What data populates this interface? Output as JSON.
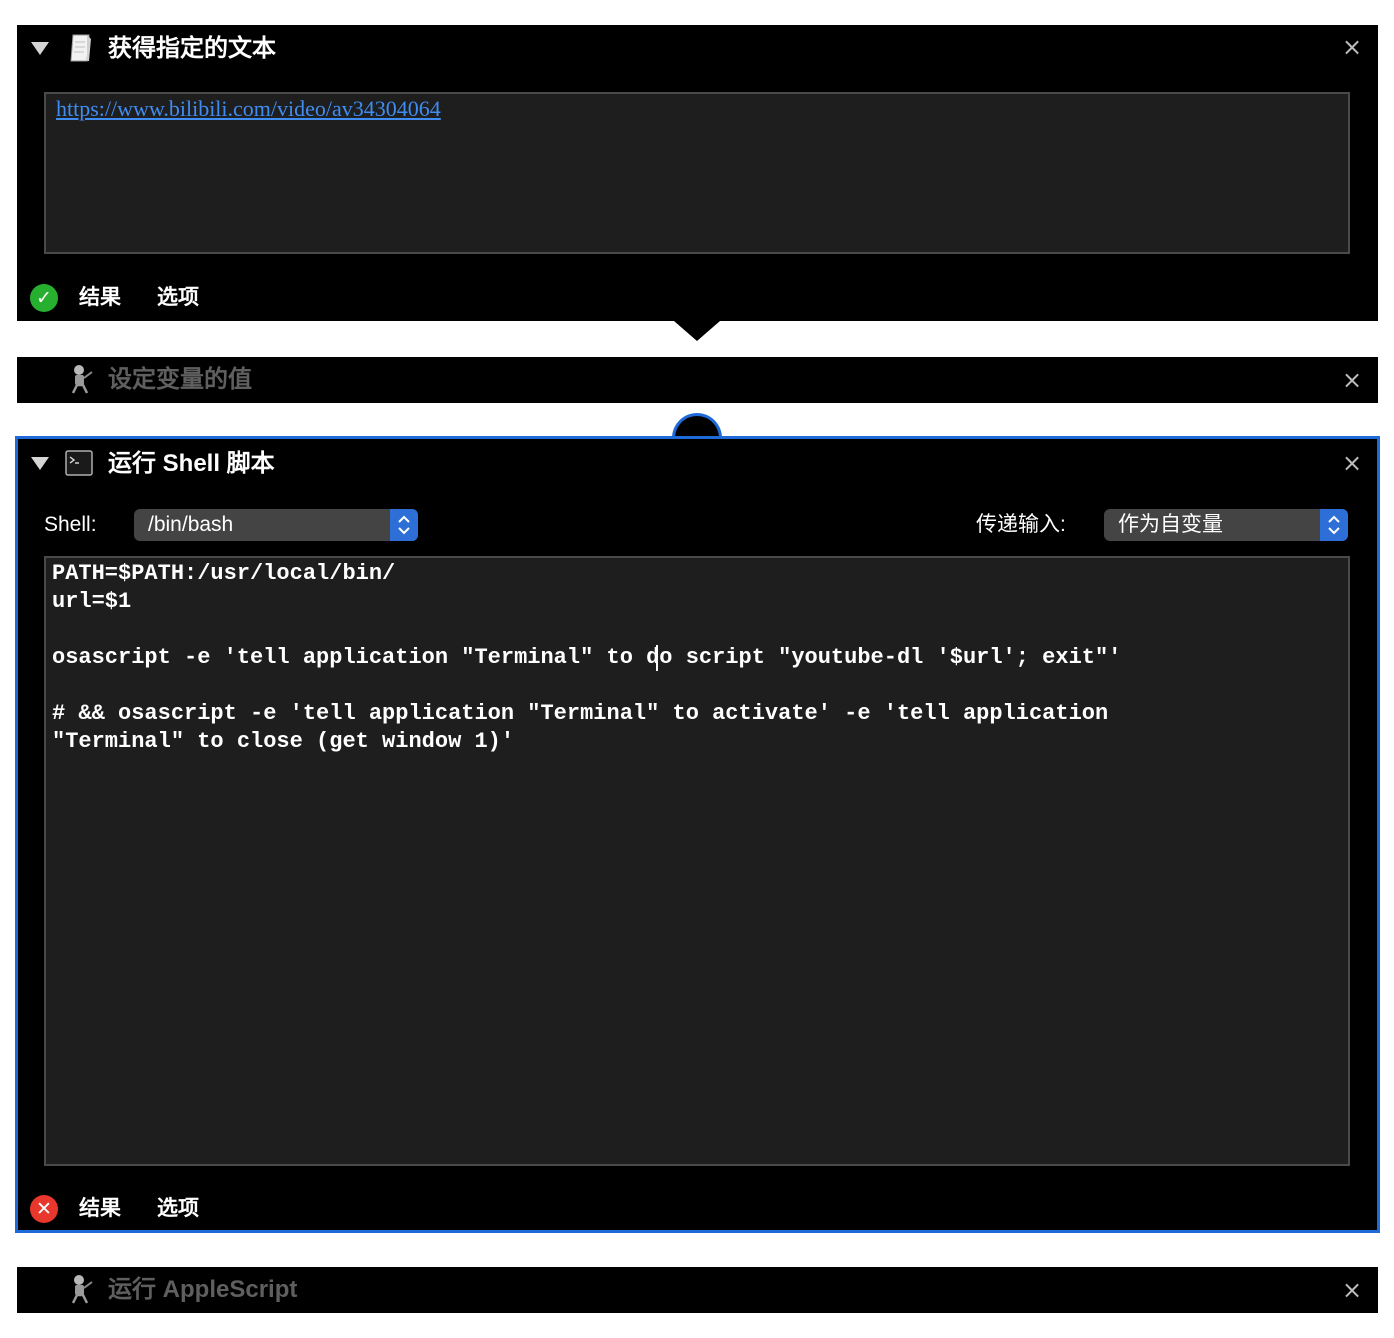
{
  "action1": {
    "title": "获得指定的文本",
    "icon": "text-document-icon",
    "text_value": "https://www.bilibili.com/video/av34304064",
    "footer": {
      "results_label": "结果",
      "options_label": "选项",
      "status": "success"
    }
  },
  "action2": {
    "title": "设定变量的值",
    "icon": "automator-robot-icon",
    "state": "disabled"
  },
  "action3": {
    "title": "运行 Shell 脚本",
    "icon": "terminal-icon",
    "shell_label": "Shell:",
    "shell_value": "/bin/bash",
    "pass_input_label": "传递输入:",
    "pass_input_value": "作为自变量",
    "script_lines": [
      "PATH=$PATH:/usr/local/bin/",
      "url=$1",
      "",
      "osascript -e 'tell application \"Terminal\" to do script \"youtube-dl '$url'; exit\"'",
      "",
      "# && osascript -e 'tell application \"Terminal\" to activate' -e 'tell application",
      "\"Terminal\" to close (get window 1)'"
    ],
    "footer": {
      "results_label": "结果",
      "options_label": "选项",
      "status": "error"
    },
    "selected": true
  },
  "action4": {
    "title": "运行 AppleScript",
    "icon": "automator-robot-icon",
    "state": "disabled"
  },
  "colors": {
    "card_bg": "#000000",
    "selection_border": "#1f6ad9",
    "link": "#3f8cf2",
    "success": "#27b030",
    "error": "#e8372c",
    "select_bg": "#444444",
    "stepper": "#2d6fd6"
  }
}
